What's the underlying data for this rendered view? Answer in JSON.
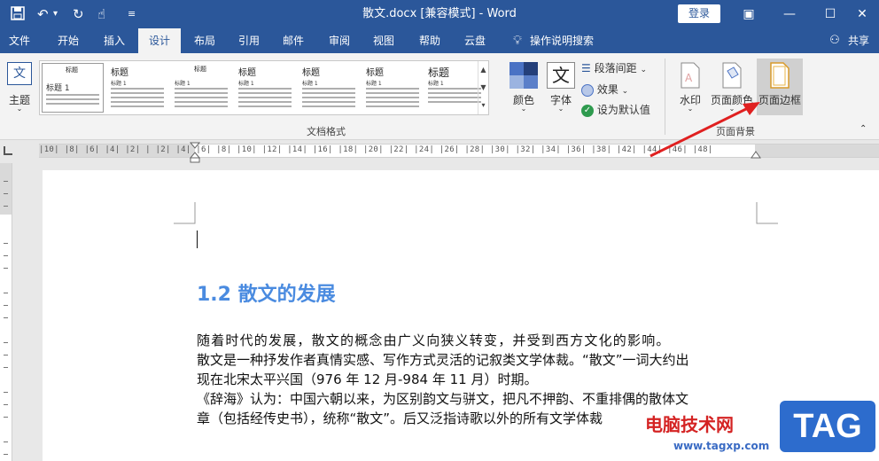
{
  "titlebar": {
    "doc_title": "散文.docx [兼容模式]  -  Word",
    "login": "登录",
    "minimize": "—",
    "restore": "☐",
    "close": "✕"
  },
  "tabs": [
    {
      "label": "文件"
    },
    {
      "label": "开始"
    },
    {
      "label": "插入"
    },
    {
      "label": "设计"
    },
    {
      "label": "布局"
    },
    {
      "label": "引用"
    },
    {
      "label": "邮件"
    },
    {
      "label": "审阅"
    },
    {
      "label": "视图"
    },
    {
      "label": "帮助"
    },
    {
      "label": "云盘"
    },
    {
      "label": "操作说明搜索"
    },
    {
      "label": "共享"
    }
  ],
  "ribbon": {
    "theme_label": "主题",
    "gallery": [
      {
        "title": "标题",
        "heading": "标题 1"
      },
      {
        "title": "标题",
        "heading": "标题 1"
      },
      {
        "title": "标题",
        "heading": "标题 1"
      },
      {
        "title": "标题",
        "heading": "标题 1"
      },
      {
        "title": "标题",
        "heading": "标题 1"
      },
      {
        "title": "标题",
        "heading": "标题 1"
      },
      {
        "title": "标题",
        "heading": "标题 1"
      }
    ],
    "colors_label": "颜色",
    "fonts_label": "字体",
    "fonts_glyph": "文",
    "paragraph_spacing": "段落间距",
    "effects": "效果",
    "set_default": "设为默认值",
    "doc_format_group": "文档格式",
    "watermark": "水印",
    "page_color": "页面颜色",
    "page_borders": "页面边框",
    "page_background_group": "页面背景"
  },
  "ruler": {
    "numbers": "|10| |8| |6| |4| |2| |  |2| |4| |6| |8| |10| |12| |14| |16| |18| |20| |22| |24| |26| |28| |30| |32| |34| |36| |38|  |42| |44| |46| |48|"
  },
  "document": {
    "heading": "1.2 散文的发展",
    "paragraphs": [
      "随着时代的发展，散文的概念由广义向狭义转变，并受到西方文化的影响。",
      "散文是一种抒发作者真情实感、写作方式灵活的记叙类文学体裁。“散文”一词大约出",
      "现在北宋太平兴国（976 年 12 月-984 年 11 月）时期。",
      "《辞海》认为：中国六朝以来，为区别韵文与骈文，把凡不押韵、不重排偶的散体文",
      "章（包括经传史书），统称“散文”。后又泛指诗歌以外的所有文学体裁"
    ]
  },
  "watermark": {
    "site": "电脑技术网",
    "url": "www.tagxp.com",
    "tag": "TAG"
  },
  "colors": {
    "accent": "#2b579a",
    "heading": "#4a8be0",
    "arrow": "#e02020"
  }
}
